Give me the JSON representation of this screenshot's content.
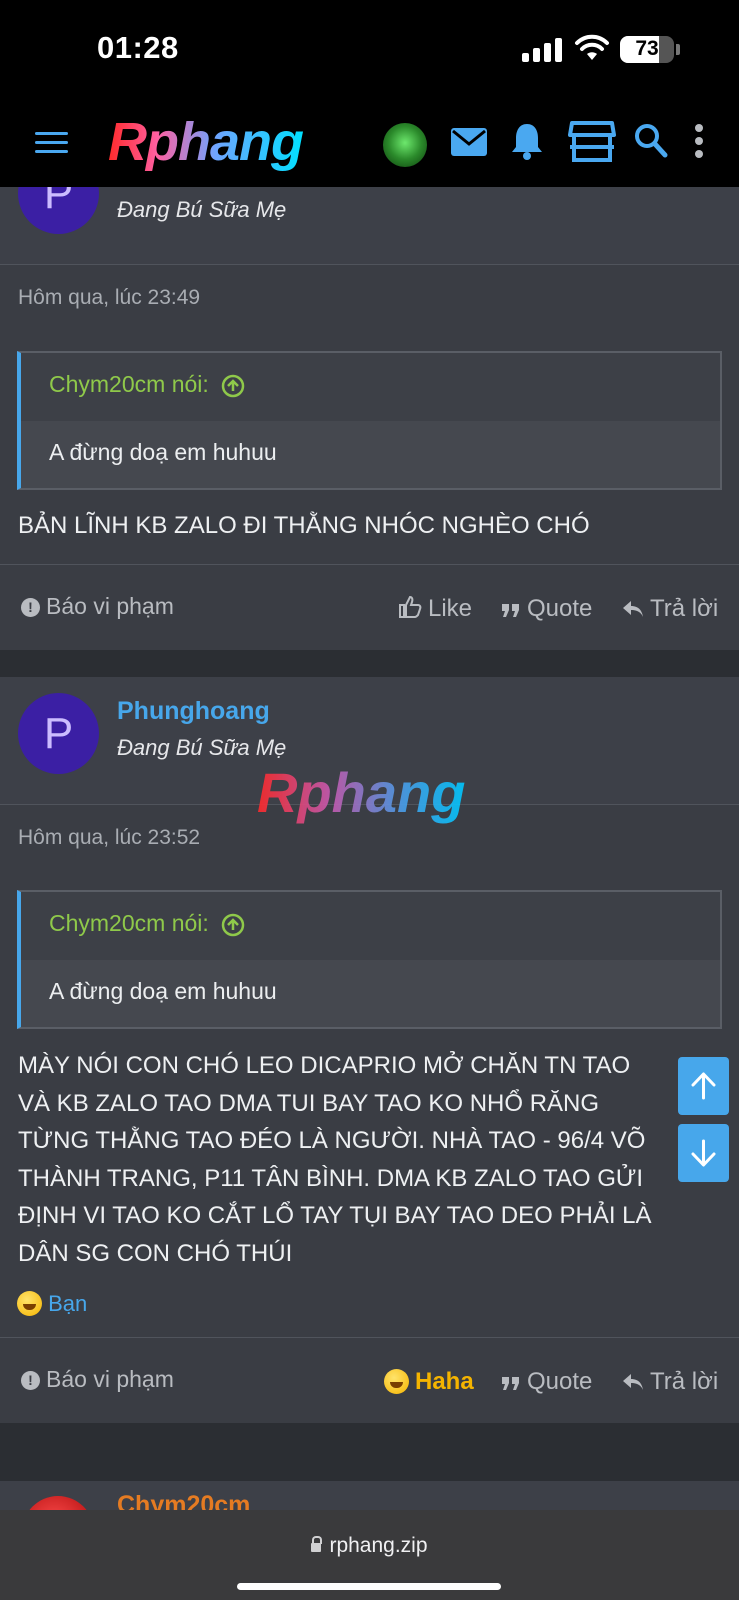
{
  "status_bar": {
    "time": "01:28",
    "battery": "73"
  },
  "header": {
    "logo": "Rphang",
    "icons": [
      "menu-icon",
      "avatar",
      "mail-icon",
      "bell-icon",
      "store-icon",
      "search-icon",
      "more-icon"
    ]
  },
  "posts": [
    {
      "usertitle": "Đang Bú Sữa Mẹ",
      "avatar_letter": "P",
      "date": "Hôm qua, lúc 23:49",
      "quote": {
        "author": "Chym20cm nói:",
        "text": "A đừng doạ em huhuu"
      },
      "message": "BẢN LĨNH KB ZALO ĐI THẰNG NHÓC NGHÈO CHÓ",
      "footer": {
        "report": "Báo vi phạm",
        "like": "Like",
        "quote": "Quote",
        "reply": "Trả lời"
      }
    },
    {
      "username": "Phunghoang",
      "usertitle": "Đang Bú Sữa Mẹ",
      "avatar_letter": "P",
      "date": "Hôm qua, lúc 23:52",
      "quote": {
        "author": "Chym20cm nói:",
        "text": "A đừng doạ em huhuu"
      },
      "message_lines": [
        "MÀY NÓI CON CHÓ LEO DICAPRIO MỞ CHĂN TN TAO",
        "VÀ KB ZALO TAO DMA TUI BAY TAO KO NHỔ RĂNG",
        "TỪNG THẰNG TAO ĐÉO LÀ NGƯỜI. NHÀ TAO - 96/4 VÕ",
        "THÀNH TRANG, P11 TÂN BÌNH. DMA KB ZALO TAO GỬI",
        "ĐỊNH VI TAO KO CẮT LỔ TAY TỤI BAY TAO DEO PHẢI LÀ",
        "DÂN SG CON CHÓ THÚI"
      ],
      "reaction": {
        "user": "Bạn",
        "emoji": "haha-emoji"
      },
      "footer": {
        "report": "Báo vi phạm",
        "reaction": "Haha",
        "quote": "Quote",
        "reply": "Trả lời"
      }
    }
  ],
  "next_post": {
    "username": "Chym20cm"
  },
  "watermark": "Rphang",
  "browser": {
    "url": "rphang.zip"
  },
  "colors": {
    "accent": "#47a7eb",
    "quote_author": "#8fc94a",
    "haha": "#f5b400",
    "next_user": "#e57b22"
  }
}
